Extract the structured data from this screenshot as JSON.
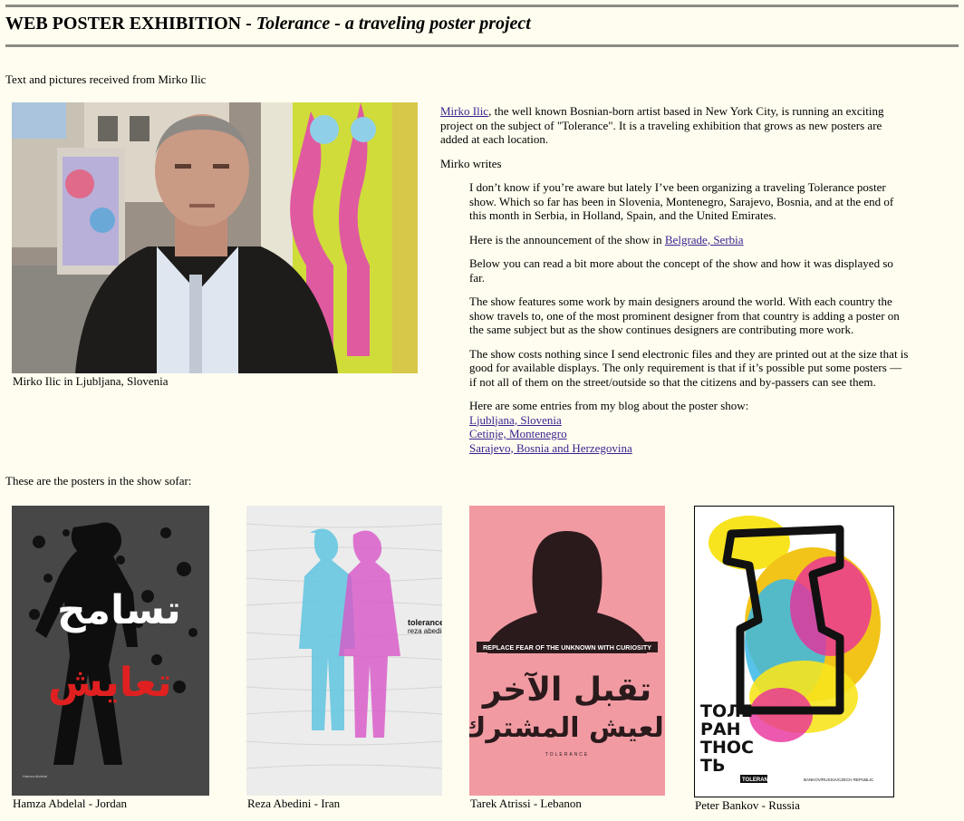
{
  "header": {
    "title_plain": "WEB POSTER EXHIBITION - ",
    "title_italic": "Tolerance - a traveling poster project"
  },
  "credit": "Text and pictures received from Mirko Ilic",
  "photo": {
    "caption": "Mirko Ilic in Ljubljana, Slovenia"
  },
  "article": {
    "p1_link": "Mirko Ilic",
    "p1_rest": ", the well known Bosnian-born artist based in New York City, is running an exciting project on the subject of \"Tolerance\". It is a traveling exhibition that grows as new posters are added at each location.",
    "p2": "Mirko writes",
    "q1": "I don’t know if you’re aware but lately I’ve been organizing a traveling Tolerance poster show. Which so far has been in Slovenia, Montenegro, Sarajevo, Bosnia, and at the end of this month in Serbia, in Holland, Spain, and the United Emirates.",
    "q2_pre": "Here is the announcement of the show in ",
    "q2_link": "Belgrade, Serbia",
    "q3": "Below you can read a bit more about the concept of the show and how it was displayed so far.",
    "q4": "The show features some work by main designers around the world. With each country the show travels to, one of the most prominent designer from that country is adding a poster on the same subject but as the show continues designers are contributing more work.",
    "q5": "The show costs nothing since I send electronic files and they are printed out at the size that is good for available displays. The only requirement is that if it’s possible put some posters — if not all of them on the street/outside so that the citizens and by-passers can see them.",
    "q6": "Here are some entries from my blog about the poster show:",
    "blog_links": [
      "Ljubljana, Slovenia",
      "Cetinje, Montenegro",
      "Sarajevo, Bosnia and Herzegovina"
    ]
  },
  "posters_intro": "These are the posters in the show sofar:",
  "posters": [
    {
      "caption": "Hamza Abdelal - Jordan",
      "colors": {
        "bg": "#474747",
        "accent": "#e02020"
      }
    },
    {
      "caption": "Reza Abedini - Iran",
      "colors": {
        "bg": "#ececec",
        "accent1": "#5fc6e0",
        "accent2": "#d856c8"
      },
      "text": [
        "tolerance",
        "reza abedini"
      ]
    },
    {
      "caption": "Tarek Atrissi - Lebanon",
      "colors": {
        "bg": "#f19aa2",
        "fg": "#2a1a1c"
      },
      "banner": "REPLACE FEAR OF THE UNKNOWN WITH CURIOSITY",
      "footer": "TOLERANCE"
    },
    {
      "caption": "Peter Bankov - Russia",
      "colors": {
        "bg": "#ffffff",
        "fg": "#111111"
      },
      "letters": [
        "ТОЛЕ",
        "РАН",
        "ТНОС",
        "ТЬ"
      ],
      "tag": "TOLERANCE",
      "credit": "BANKOV/RUSSIA/CZECH REPUBLIC"
    }
  ]
}
